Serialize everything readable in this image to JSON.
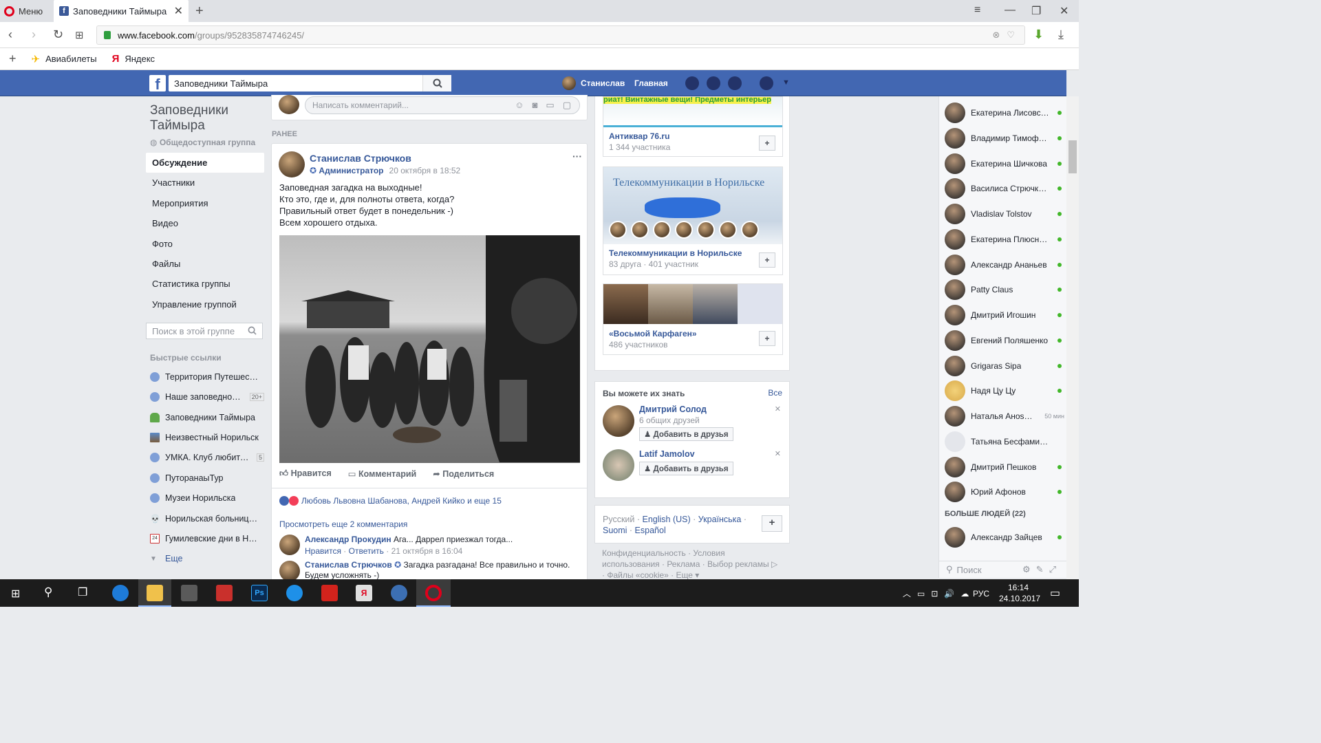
{
  "browser": {
    "menu_label": "Меню",
    "tab_title": "Заповедники Таймыра",
    "url_host": "www.facebook.com",
    "url_path": "/groups/952835874746245/",
    "bookmarks": [
      "Авиабилеты",
      "Яндекс"
    ]
  },
  "fb_header": {
    "search_value": "Заповедники Таймыра",
    "profile_name": "Станислав",
    "home_label": "Главная"
  },
  "group": {
    "title": "Заповедники Таймыра",
    "type": "Общедоступная группа",
    "nav": [
      "Обсуждение",
      "Участники",
      "Мероприятия",
      "Видео",
      "Фото",
      "Файлы",
      "Статистика группы",
      "Управление группой"
    ],
    "search_placeholder": "Поиск в этой группе",
    "quick_links_title": "Быстрые ссылки",
    "quick_links": [
      {
        "label": "Территория Путешест…",
        "badge": ""
      },
      {
        "label": "Наше заповедное …",
        "badge": "20+"
      },
      {
        "label": "Заповедники Таймыра",
        "badge": ""
      },
      {
        "label": "Неизвестный Норильск",
        "badge": ""
      },
      {
        "label": "УМКА. Клуб любите…",
        "badge": "5"
      },
      {
        "label": "ПуторанаыТур",
        "badge": ""
      },
      {
        "label": "Музеи Норильска",
        "badge": ""
      },
      {
        "label": "Норильская больница …",
        "badge": ""
      },
      {
        "label": "Гумилевские дни в Но…",
        "badge": ""
      }
    ],
    "more_label": "Еще"
  },
  "feed": {
    "comment_placeholder": "Написать комментарий...",
    "earlier_label": "РАНЕЕ",
    "post": {
      "author": "Станислав Стрючков",
      "role": "Администратор",
      "time": "20 октября в 18:52",
      "text_lines": [
        "Заповедная загадка на выходные!",
        "Кто это, где и, для полноты ответа, когда?",
        "Правильный ответ будет в понедельник -)",
        "Всем хорошего отдыха."
      ],
      "actions": [
        "Нравится",
        "Комментарий",
        "Поделиться"
      ],
      "reactions": "Любовь Львовна Шабанова, Андрей Кийко и еще 15",
      "view_more": "Просмотреть еще 2 комментария",
      "comments": [
        {
          "author": "Александр Прокудин",
          "text": "Ага... Даррел приезжал тогда...",
          "like": "Нравится",
          "reply": "Ответить",
          "time": "21 октября в 16:04"
        },
        {
          "author": "Станислав Стрючков",
          "text": "Загадка разгадана! Все правильно и точно. Будем усложнять -)"
        }
      ]
    }
  },
  "right": {
    "groups": [
      {
        "banner_text": "риат! Винтажные вещи! Предметы интерьер",
        "name": "Антиквар 76.ru",
        "sub": "1 344 участника"
      },
      {
        "banner_text": "Телекоммуникации в Норильске",
        "name": "Телекоммуникации в Норильске",
        "sub": "83 друга · 401 участник"
      },
      {
        "banner_text": "",
        "name": "«Восьмой Карфаген»",
        "sub": "486 участников"
      }
    ],
    "pymk_title": "Вы можете их знать",
    "pymk_all": "Все",
    "pymk": [
      {
        "name": "Дмитрий Солод",
        "mutual": "6 общих друзей",
        "button": "Добавить в друзья"
      },
      {
        "name": "Latif Jamolov",
        "mutual": "",
        "button": "Добавить в друзья"
      }
    ],
    "languages": [
      "Русский",
      "English (US)",
      "Українська",
      "Suomi",
      "Español"
    ],
    "footer_links": [
      "Конфиденциальность",
      "Условия использования",
      "Реклама",
      "Выбор рекламы",
      "Файлы «cookie»",
      "Еще"
    ]
  },
  "chat": {
    "contacts": [
      {
        "name": "Екатерина Лисовская",
        "status": "online"
      },
      {
        "name": "Владимир Тимофеев",
        "status": "online"
      },
      {
        "name": "Екатерина Шичкова",
        "status": "online"
      },
      {
        "name": "Василиса Стрючкова",
        "status": "online"
      },
      {
        "name": "Vladislav Tolstov",
        "status": "online"
      },
      {
        "name": "Екатерина Плюснина",
        "status": "online"
      },
      {
        "name": "Александр Ананьев",
        "status": "online"
      },
      {
        "name": "Patty Claus",
        "status": "online"
      },
      {
        "name": "Дмитрий Игошин",
        "status": "online"
      },
      {
        "name": "Евгений Поляшенко",
        "status": "online"
      },
      {
        "name": "Grigaras Sipa",
        "status": "online"
      },
      {
        "name": "Надя Цу Цу",
        "status": "online"
      },
      {
        "name": "Наталья Аноshина",
        "status": "50 мин"
      },
      {
        "name": "Татьяна Бесфамиль…",
        "status": ""
      },
      {
        "name": "Дмитрий Пешков",
        "status": "online"
      },
      {
        "name": "Юрий Афонов",
        "status": "online"
      }
    ],
    "more_people": "БОЛЬШЕ ЛЮДЕЙ (22)",
    "more_contacts": [
      {
        "name": "Александр Зайцев",
        "status": "online"
      }
    ],
    "search_placeholder": "Поиск"
  },
  "taskbar": {
    "time": "16:14",
    "date": "24.10.2017",
    "lang": "РУС"
  }
}
